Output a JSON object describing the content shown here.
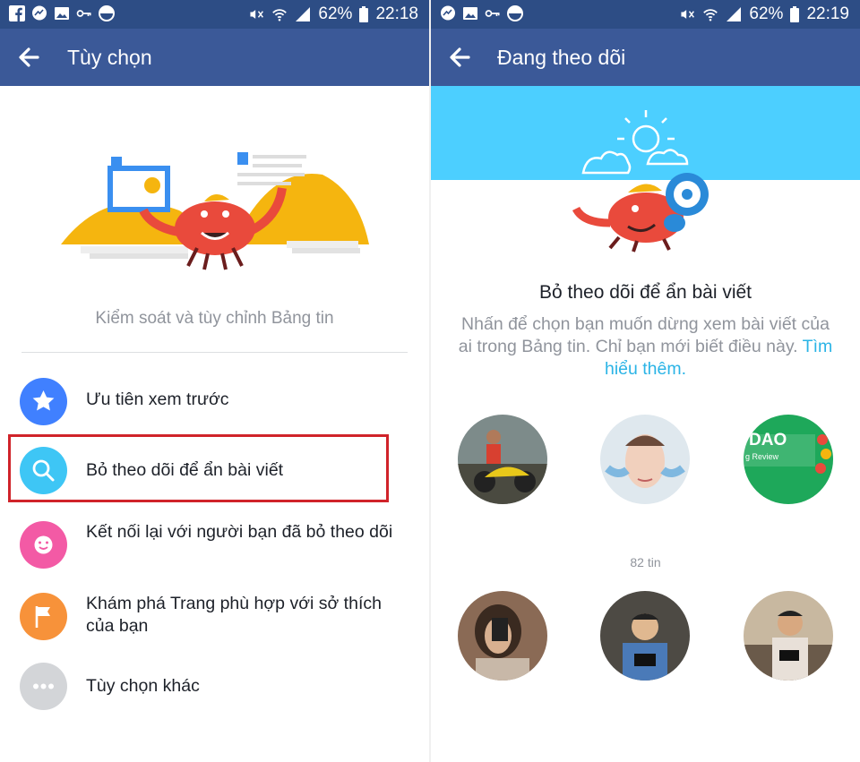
{
  "left": {
    "status": {
      "battery": "62%",
      "time": "22:18"
    },
    "title": "Tùy chọn",
    "subtitle": "Kiểm soát và tùy chỉnh Bảng tin",
    "options": [
      {
        "label": "Ưu tiên xem trước",
        "icon": "star-icon",
        "color": "#4080ff"
      },
      {
        "label": "Bỏ theo dõi để ẩn bài viết",
        "icon": "search-icon",
        "color": "#3ec6f5"
      },
      {
        "label": "Kết nối lại với người bạn đã bỏ theo dõi",
        "icon": "smiley-icon",
        "color": "#f35aa5"
      },
      {
        "label": "Khám phá Trang phù hợp với sở thích của bạn",
        "icon": "flag-icon",
        "color": "#f7923a"
      },
      {
        "label": "Tùy chọn khác",
        "icon": "more-icon",
        "color": "#d3d5d8"
      }
    ]
  },
  "right": {
    "status": {
      "battery": "62%",
      "time": "22:19"
    },
    "title": "Đang theo dõi",
    "heading": "Bỏ theo dõi để ẩn bài viết",
    "description": "Nhấn để chọn bạn muốn dừng xem bài viết của ai trong Bảng tin. Chỉ bạn mới biết điều này.",
    "link": "Tìm hiểu thêm.",
    "count_label": "82 tin",
    "avatar_badge_text": "DAO",
    "avatar_badge_sub": "g Review"
  }
}
